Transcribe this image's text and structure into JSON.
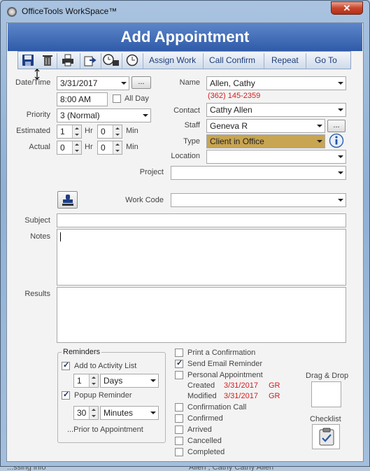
{
  "window": {
    "title": "OfficeTools WorkSpace™",
    "close_glyph": "✕"
  },
  "header": {
    "title": "Add Appointment"
  },
  "toolbar": {
    "icons": [
      "save-icon",
      "delete-icon",
      "print-icon",
      "export-icon",
      "clock-group-icon",
      "clock-icon"
    ],
    "assign_work": "Assign Work",
    "call_confirm": "Call Confirm",
    "repeat": "Repeat",
    "go_to": "Go To"
  },
  "form": {
    "date_time_label": "Date/Time",
    "date_value": "3/31/2017",
    "browse_label": "...",
    "time_value": "8:00 AM",
    "all_day_label": "All Day",
    "priority_label": "Priority",
    "priority_value": "3 (Normal)",
    "estimated_label": "Estimated",
    "estimated_hr": "1",
    "estimated_min": "0",
    "actual_label": "Actual",
    "actual_hr": "0",
    "actual_min": "0",
    "hr_label": "Hr",
    "min_label": "Min",
    "name_label": "Name",
    "name_value": "Allen, Cathy",
    "phone": "(362) 145-2359",
    "contact_label": "Contact",
    "contact_value": "Cathy Allen",
    "staff_label": "Staff",
    "staff_value": "Geneva R",
    "type_label": "Type",
    "type_value": "Client in Office",
    "type_color": "#c8a552",
    "location_label": "Location",
    "location_value": "",
    "project_label": "Project",
    "project_value": "",
    "work_code_label": "Work Code",
    "work_code_value": "",
    "subject_label": "Subject",
    "subject_value": "",
    "notes_label": "Notes",
    "results_label": "Results"
  },
  "reminders": {
    "title": "Reminders",
    "add_to_activity": "Add to Activity List",
    "add_to_activity_checked": true,
    "activity_count": "1",
    "activity_unit": "Days",
    "popup_reminder": "Popup Reminder",
    "popup_checked": true,
    "popup_count": "30",
    "popup_unit": "Minutes",
    "prior": "...Prior to Appointment"
  },
  "options": {
    "print_confirmation": "Print a Confirmation",
    "send_email": "Send Email Reminder",
    "personal": "Personal Appointment",
    "created_label": "Created",
    "created_date": "3/31/2017",
    "created_by": "GR",
    "modified_label": "Modified",
    "modified_date": "3/31/2017",
    "modified_by": "GR",
    "confirmation_call": "Confirmation Call",
    "confirmed": "Confirmed",
    "arrived": "Arrived",
    "cancelled": "Cancelled",
    "completed": "Completed"
  },
  "side": {
    "drag_drop": "Drag & Drop",
    "checklist": "Checklist"
  },
  "background": {
    "left_text": "...ssing info",
    "right_text": "Allen , Cathy   Cathy Allen"
  }
}
